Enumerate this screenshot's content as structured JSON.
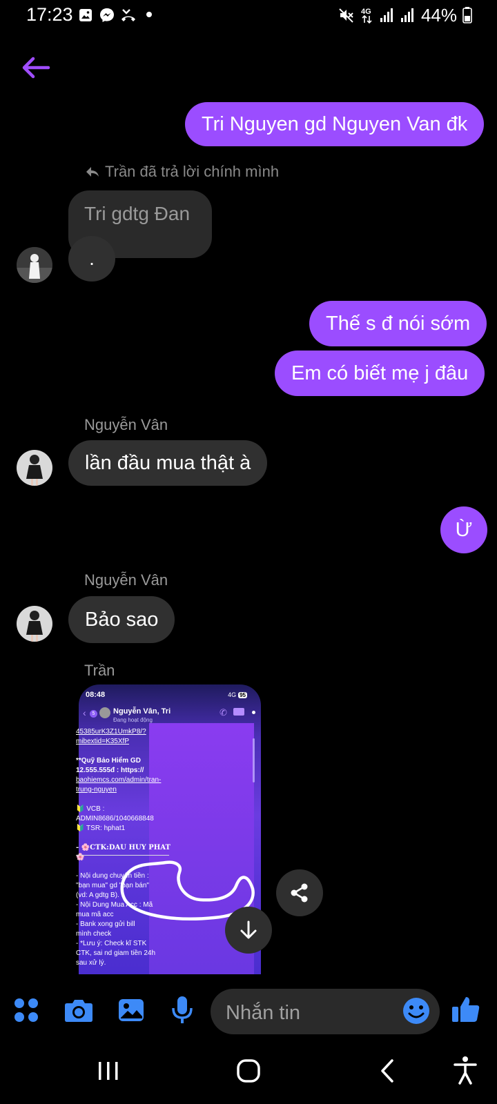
{
  "status_bar": {
    "time": "17:23",
    "battery": "44%",
    "network": "4G",
    "left_icons": [
      "gallery-icon",
      "messenger-icon",
      "missed-call-icon",
      "dot-icon"
    ],
    "right_icons": [
      "mute-icon",
      "4g-icon",
      "signal-icon",
      "signal-icon",
      "battery-icon"
    ]
  },
  "header": {
    "back_icon": "back-arrow-icon"
  },
  "messages": {
    "m1": "Tri Nguyen gd Nguyen Van đk",
    "reply_label": "Trần đã trả lời chính mình",
    "reply_quote": "Tri gdtg Đan",
    "reply_text": ".",
    "m3": "Thế s đ nói sớm",
    "m4": "Em có biết mẹ j đâu",
    "sender_van": "Nguyễn Vân",
    "m5": "lần đầu mua thật à",
    "m6": "Ừ",
    "m7": "Bảo sao",
    "sender_tran": "Trần"
  },
  "shared_screenshot": {
    "time": "08:48",
    "network": "4G",
    "battery": "95",
    "badge": "5",
    "chat_title": "Nguyễn Vân, Tri",
    "chat_status": "Đang hoạt động",
    "lines": [
      "45385urK3Z1UmkP8/?",
      "mibextid=K35XfP",
      "**Quỹ Bảo Hiểm GD",
      "12.555.555đ : https://",
      "baohiemcs.com/admin/tran-",
      "trung-nguyen",
      "🔰 VCB :",
      "ADMIN8686/1040668848",
      "🔰 TSR: hphat1",
      "- 🌸CTK:DAU HUY PHAT",
      "🌸",
      "- Nội dung chuyển tiền :",
      "\"bạn mua\" gd \"bạn bán\"",
      "(vd: A gdtg B).",
      "- Nội Dung Mua Acc : Mã",
      "mua mã acc",
      "- Bank xong gửi bill",
      "mình check",
      "- *Lưu ý: Check kĩ STK",
      "CTK, sai nd giam tiền 24h",
      "sau xử lý."
    ]
  },
  "actions": {
    "share_icon": "share-icon",
    "scroll_down_icon": "arrow-down-icon"
  },
  "composer": {
    "placeholder": "Nhắn tin",
    "icons": [
      "menu-icon",
      "camera-icon",
      "gallery-icon",
      "mic-icon",
      "emoji-icon",
      "thumbs-up-icon"
    ]
  },
  "colors": {
    "outgoing": "#9b4dff",
    "incoming": "#303030",
    "accent_blue": "#3d8af7",
    "back_purple": "#a04dff"
  },
  "navbar": {
    "icons": [
      "recent-apps-icon",
      "home-icon",
      "back-icon",
      "accessibility-icon"
    ]
  }
}
